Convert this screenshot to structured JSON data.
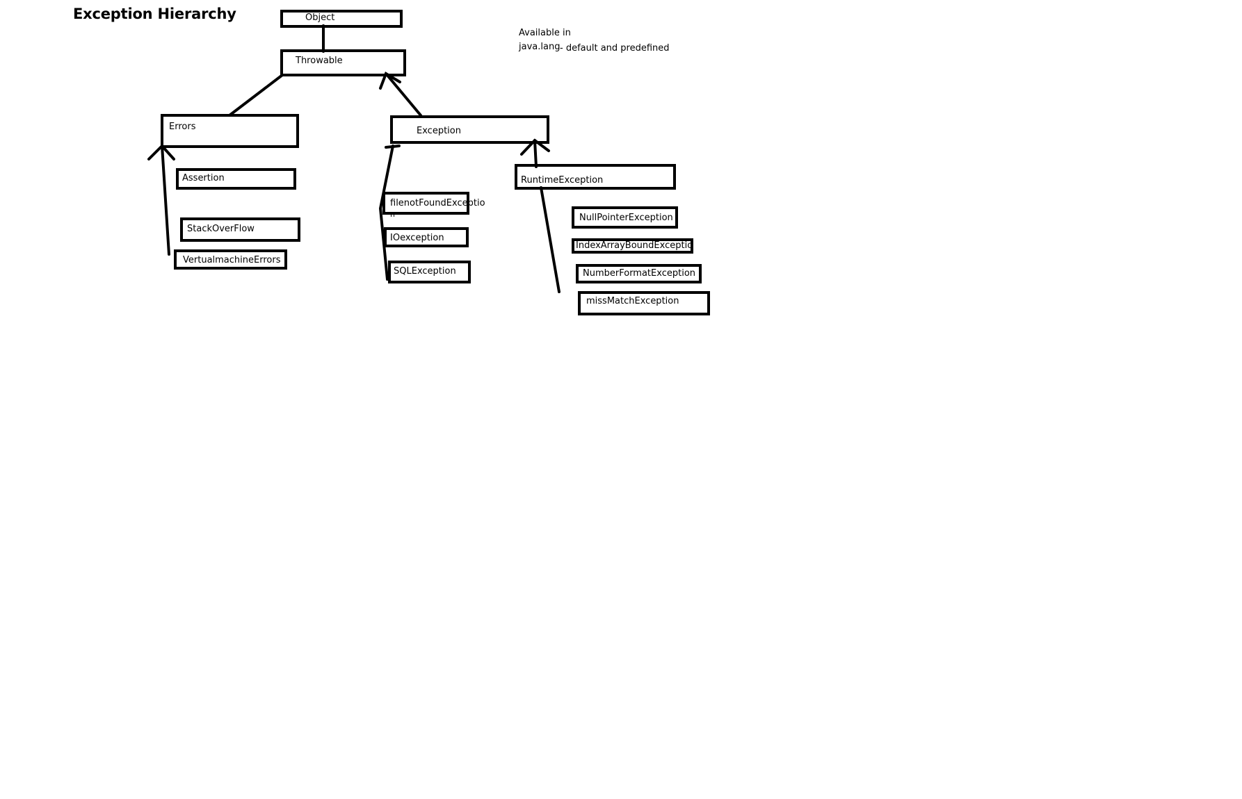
{
  "page": {
    "title": "Exception Hierarchy",
    "note_line1": "Available in",
    "note_line2a": "java.lang",
    "note_line2b": "- default and predefined"
  },
  "nodes": {
    "object": "Object",
    "throwable": "Throwable",
    "errors": "Errors",
    "exception": "Exception",
    "assertion": "Assertion",
    "stackoverflow": "StackOverFlow",
    "virtualmachine_errors": "VertualmachineErrors",
    "filenotfound": "filenotFoundExceptio",
    "filenotfound_wrap": "n",
    "ioexception": "IOexception",
    "sqlexception": "SQLException",
    "runtime_exception": "RuntimeException",
    "nullpointer": "NullPointerException",
    "indexarraybound": "IndexArrayBoundExceptio",
    "numberformat": "NumberFormatException",
    "missmatch": "missMatchException"
  },
  "colors": {
    "stroke": "#000000",
    "background": "#ffffff"
  }
}
